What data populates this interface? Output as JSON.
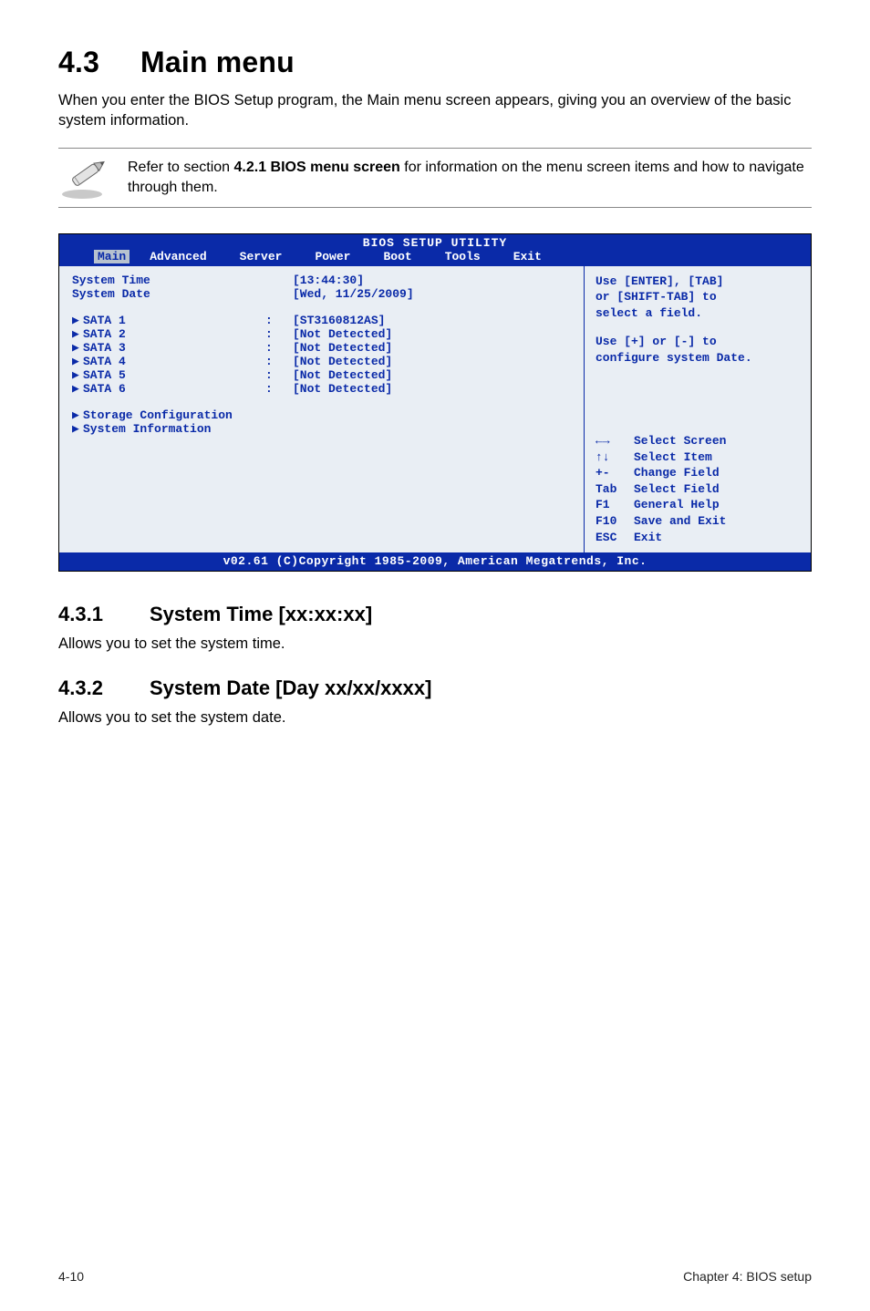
{
  "section": {
    "num": "4.3",
    "title": "Main menu"
  },
  "intro": "When you enter the BIOS Setup program, the Main menu screen appears, giving you an overview of the basic system information.",
  "note": {
    "text_a": "Refer to section ",
    "ref": "4.2.1 BIOS menu screen",
    "text_b": " for information on the menu screen items and how to navigate through them."
  },
  "bios": {
    "title": "BIOS SETUP UTILITY",
    "tabs": [
      "Main",
      "Advanced",
      "Server",
      "Power",
      "Boot",
      "Tools",
      "Exit"
    ],
    "selected_tab": "Main",
    "left_rows_top": [
      {
        "label": "System Time",
        "colon": "",
        "value": "[13:44:30]",
        "bold": true
      },
      {
        "label": "System Date",
        "colon": "",
        "value": "[Wed, 11/25/2009]",
        "bold": true
      }
    ],
    "sata_rows": [
      {
        "label": "SATA 1",
        "value": "[ST3160812AS]"
      },
      {
        "label": "SATA 2",
        "value": "[Not Detected]"
      },
      {
        "label": "SATA 3",
        "value": "[Not Detected]"
      },
      {
        "label": "SATA 4",
        "value": "[Not Detected]"
      },
      {
        "label": "SATA 5",
        "value": "[Not Detected]"
      },
      {
        "label": "SATA 6",
        "value": "[Not Detected]"
      }
    ],
    "bottom_items": [
      "Storage Configuration",
      "System Information"
    ],
    "help_lines": [
      "Use [ENTER], [TAB]",
      "or [SHIFT-TAB] to",
      "select a field.",
      "",
      "Use [+] or [-] to",
      "configure system Date."
    ],
    "keys": [
      {
        "k": "←→",
        "d": "Select Screen"
      },
      {
        "k": "↑↓",
        "d": "Select Item"
      },
      {
        "k": "+-",
        "d": "Change Field"
      },
      {
        "k": "Tab",
        "d": "Select Field"
      },
      {
        "k": "F1",
        "d": "General Help"
      },
      {
        "k": "F10",
        "d": "Save and Exit"
      },
      {
        "k": "ESC",
        "d": "Exit"
      }
    ],
    "footer": "v02.61 (C)Copyright 1985-2009, American Megatrends, Inc."
  },
  "subsections": [
    {
      "num": "4.3.1",
      "title": "System Time [xx:xx:xx]",
      "body": "Allows you to set the system time."
    },
    {
      "num": "4.3.2",
      "title": "System Date [Day xx/xx/xxxx]",
      "body": "Allows you to set the system date."
    }
  ],
  "footer": {
    "left": "4-10",
    "right": "Chapter 4: BIOS setup"
  },
  "chart_data": {
    "type": "table",
    "title": "BIOS Main menu values",
    "rows": [
      {
        "field": "System Time",
        "value": "13:44:30"
      },
      {
        "field": "System Date",
        "value": "Wed, 11/25/2009"
      },
      {
        "field": "SATA 1",
        "value": "ST3160812AS"
      },
      {
        "field": "SATA 2",
        "value": "Not Detected"
      },
      {
        "field": "SATA 3",
        "value": "Not Detected"
      },
      {
        "field": "SATA 4",
        "value": "Not Detected"
      },
      {
        "field": "SATA 5",
        "value": "Not Detected"
      },
      {
        "field": "SATA 6",
        "value": "Not Detected"
      }
    ]
  }
}
